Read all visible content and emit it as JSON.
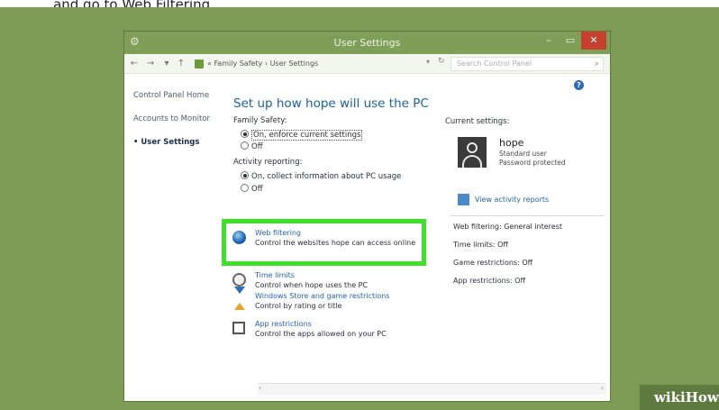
{
  "top_caption": "... and go to Web Filtering.",
  "window": {
    "title": "User Settings",
    "minimize": "–",
    "maximize": "▭",
    "close": "✕"
  },
  "address_bar": {
    "back": "←",
    "forward": "→",
    "dropdown": "▾",
    "up": "↑",
    "path": "« Family Safety › User Settings",
    "addr_drop": "▾",
    "refresh": "↻",
    "search_placeholder": "Search Control Panel",
    "search_icon": "⌕"
  },
  "nav": {
    "items": [
      "Control Panel Home",
      "Accounts to Monitor",
      "• User Settings"
    ]
  },
  "main": {
    "heading": "Set up how hope will use the PC",
    "help": "?",
    "family_safety_label": "Family Safety:",
    "family_on": "On, enforce current settings",
    "family_off": "Off",
    "activity_label": "Activity reporting:",
    "activity_on": "On, collect information about PC usage",
    "activity_off": "Off"
  },
  "items": [
    {
      "title": "Web filtering",
      "desc": "Control the websites hope can access online",
      "icon": "globe-icon"
    },
    {
      "title": "Time limits",
      "desc": "Control when hope uses the PC",
      "icon": "clock-icon"
    },
    {
      "title": "Windows Store and game restrictions",
      "desc": "Control by rating or title",
      "icon": "hourglass-icon"
    },
    {
      "title": "App restrictions",
      "desc": "Control the apps allowed on your PC",
      "icon": "app-icon"
    }
  ],
  "current": {
    "label": "Current settings:",
    "name": "hope",
    "role": "Standard user",
    "password": "Password protected",
    "report_link": "View activity reports",
    "settings": [
      "Web filtering: General interest",
      "Time limits: Off",
      "Game restrictions: Off",
      "App restrictions: Off"
    ]
  },
  "scroll": {
    "left": "‹",
    "right": "›"
  },
  "watermark": "wikiHow",
  "colors": {
    "desktop": "#7e9b55",
    "titlebar": "#7f9e57",
    "close": "#c7402f",
    "link": "#2464b0",
    "highlight": "#3fe02a"
  }
}
